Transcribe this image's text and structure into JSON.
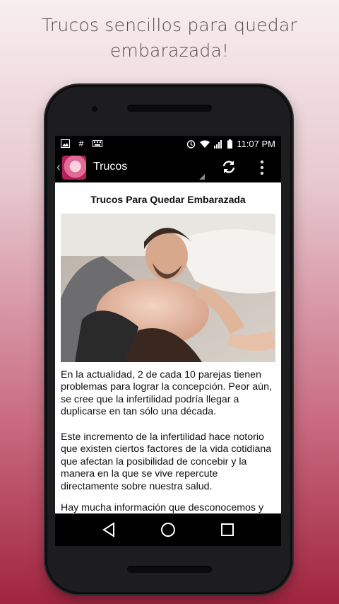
{
  "promo": {
    "headline_line1": "Trucos sencillos para quedar",
    "headline_line2": "embarazada!"
  },
  "status_bar": {
    "time": "11:07 PM",
    "left_icons": [
      "image-icon",
      "hash-icon",
      "keyboard-icon"
    ],
    "right_icons": [
      "alarm-icon",
      "wifi-icon",
      "signal-icon",
      "battery-icon"
    ]
  },
  "app_bar": {
    "title": "Trucos",
    "icons": [
      "app-logo",
      "refresh-icon",
      "overflow-menu-icon"
    ]
  },
  "article": {
    "title": "Trucos Para Quedar Embarazada",
    "paragraphs": [
      "En la actualidad, 2 de cada 10 parejas tienen problemas para lograr la concepción. Peor aún, se cree que la infertilidad podría llegar a duplicarse en tan sólo una década.",
      "Este incremento de la infertilidad hace notorio que existen ciertos factores de la vida cotidiana que afectan la posibilidad de concebir y la manera en la que se vive repercute directamente sobre nuestra salud.",
      "Hay mucha información que desconocemos y"
    ]
  },
  "nav_bar": {
    "icons": [
      "back-icon",
      "home-icon",
      "recents-icon"
    ]
  },
  "colors": {
    "background_top": "#f7eef0",
    "background_bottom": "#a0243e",
    "phone_body": "#1d1d1f",
    "app_bar": "#000000"
  }
}
